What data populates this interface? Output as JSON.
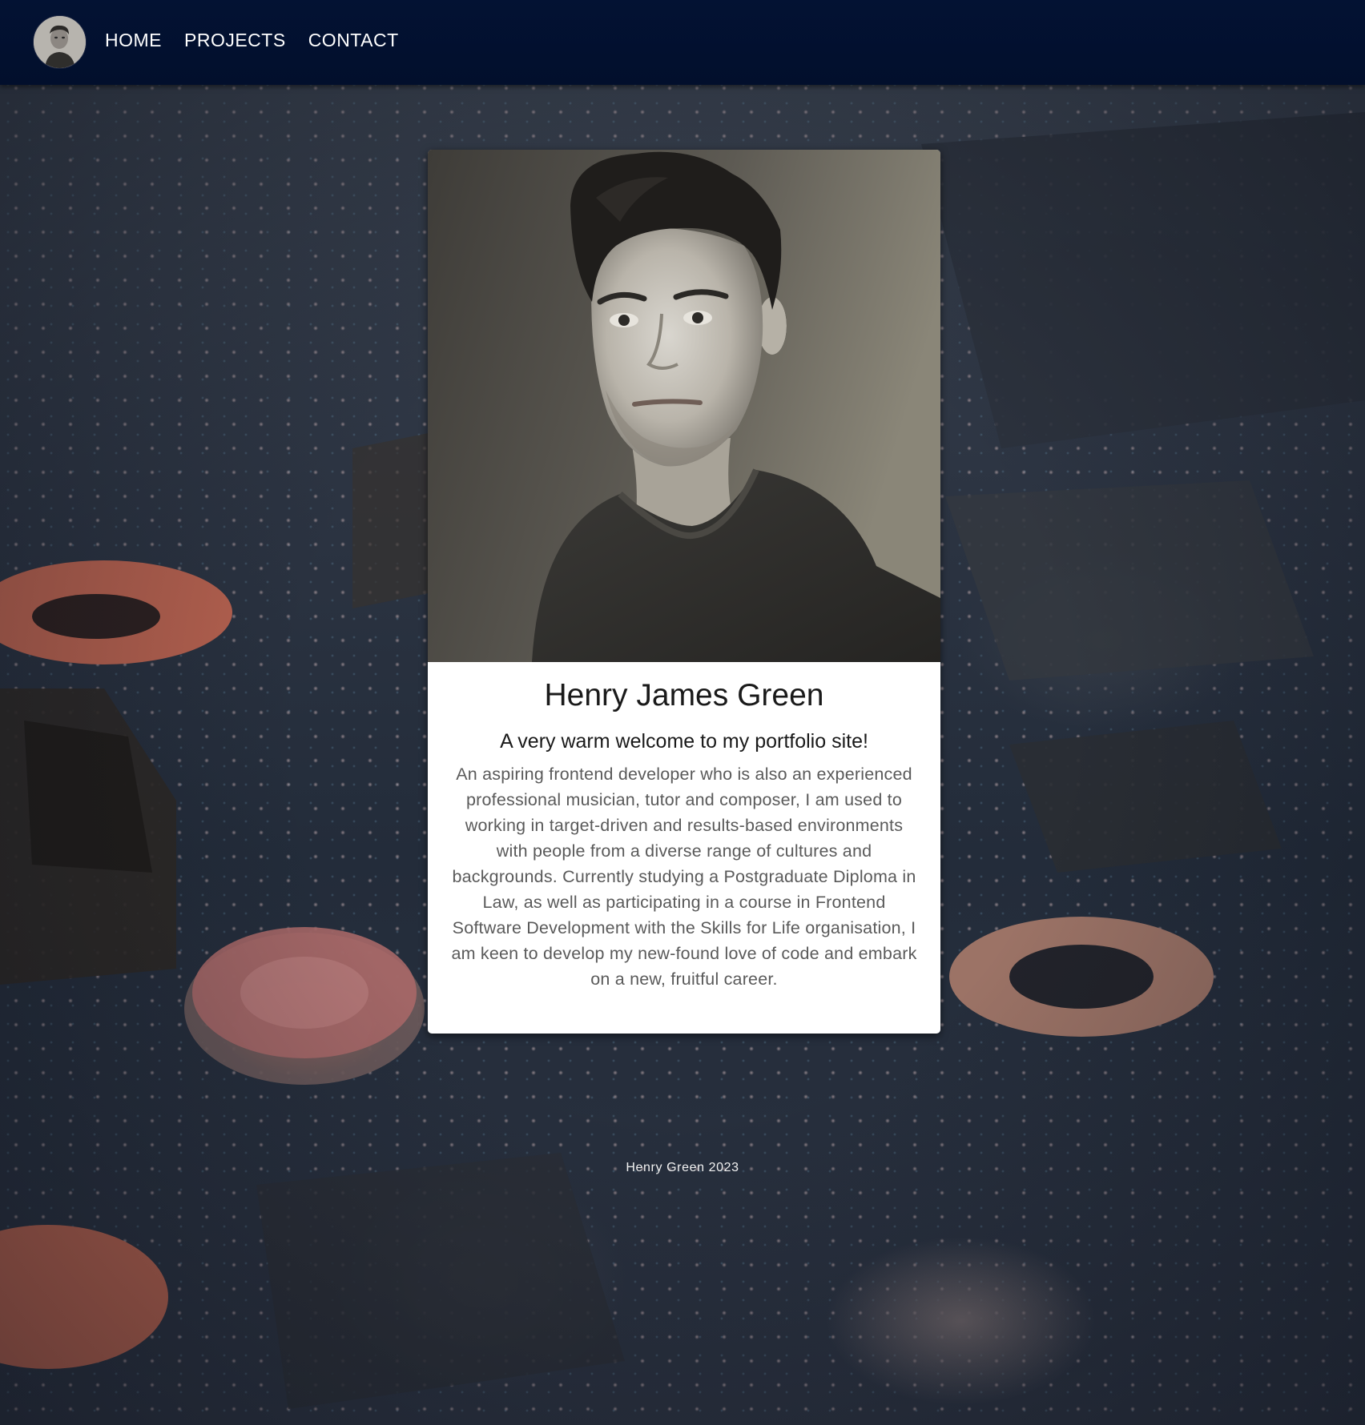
{
  "nav": {
    "avatar_alt": "Henry James Green profile photo",
    "links": [
      {
        "label": "HOME"
      },
      {
        "label": "PROJECTS"
      },
      {
        "label": "CONTACT"
      }
    ]
  },
  "card": {
    "name": "Henry James Green",
    "welcome": "A very warm welcome to my portfolio site!",
    "bio": "An aspiring frontend developer who is also an experienced professional musician, tutor and composer, I am used to working in target-driven and results-based environments with people from a diverse range of cultures and backgrounds. Currently studying a Postgraduate Diploma in Law, as well as participating in a course in Frontend Software Development with the Skills for Life organisation, I am keen to develop my new-found love of code and embark on a new, fruitful career."
  },
  "footer": {
    "text": "Henry Green 2023"
  },
  "colors": {
    "navbar": "#031233",
    "card_background": "#ffffff",
    "heading_text": "#1a1a1a",
    "body_text": "#5a5a5a",
    "nav_text": "#ffffff"
  },
  "icons": {
    "background": "circuit-board-photo",
    "portrait": "portrait-photo"
  }
}
